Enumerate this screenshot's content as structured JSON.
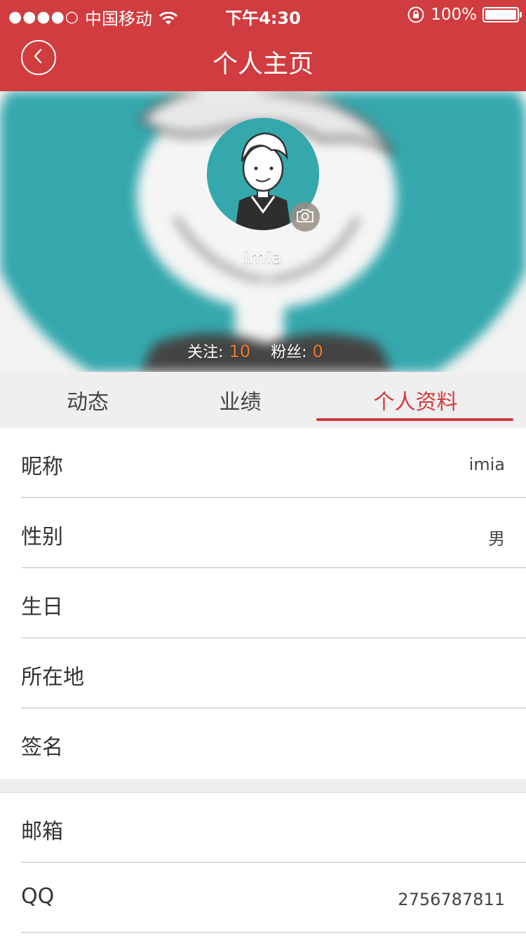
{
  "status_bar": {
    "signal_dots": "●●●●○",
    "carrier": "中国移动",
    "time": "下午4:30",
    "battery": "100%"
  },
  "nav": {
    "title": "个人主页"
  },
  "profile": {
    "username": "imia",
    "following_label": "关注:",
    "following_count": "10",
    "followers_label": "粉丝:",
    "followers_count": "0"
  },
  "tabs": [
    {
      "label": "动态",
      "active": false
    },
    {
      "label": "业绩",
      "active": false
    },
    {
      "label": "个人资料",
      "active": true
    }
  ],
  "fields_group1": [
    {
      "label": "昵称",
      "value": "imia"
    },
    {
      "label": "性别",
      "value": "男"
    },
    {
      "label": "生日",
      "value": ""
    },
    {
      "label": "所在地",
      "value": ""
    },
    {
      "label": "签名",
      "value": ""
    }
  ],
  "fields_group2": [
    {
      "label": "邮箱",
      "value": ""
    },
    {
      "label": "QQ",
      "value": "2756787811"
    }
  ],
  "colors": {
    "brand_red": "#d03c3f",
    "accent_orange": "#f07a2a",
    "avatar_teal": "#35a8ad"
  },
  "icons": [
    "back-arrow-icon",
    "wifi-icon",
    "orientation-lock-icon",
    "battery-icon",
    "camera-icon"
  ]
}
